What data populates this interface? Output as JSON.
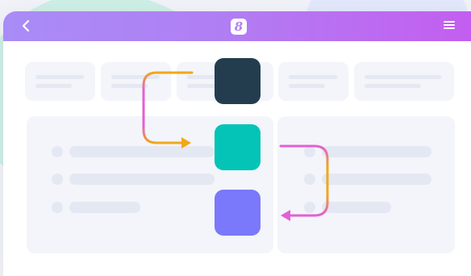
{
  "titlebar": {
    "back_icon": "chevron-left-icon",
    "logo_glyph": "8",
    "menu_icon": "hamburger-menu-icon"
  },
  "colors": {
    "titlebar_gradient_start": "#a98cf6",
    "titlebar_gradient_end": "#c35ef0",
    "tile_dark": "#233d4f",
    "tile_teal": "#03c4b6",
    "tile_violet": "#7a78fb",
    "arrow_gradient_start": "#f0a818",
    "arrow_gradient_end": "#e35fd6",
    "placeholder": "#e4e8f2",
    "card_background": "#f3f5fa"
  },
  "flow": {
    "steps": [
      {
        "name": "step-1",
        "color": "#233d4f"
      },
      {
        "name": "step-2",
        "color": "#03c4b6"
      },
      {
        "name": "step-3",
        "color": "#7a78fb"
      }
    ],
    "connectors": [
      {
        "from": "step-1",
        "to": "step-2",
        "side": "left"
      },
      {
        "from": "step-2",
        "to": "step-3",
        "side": "right"
      }
    ]
  }
}
